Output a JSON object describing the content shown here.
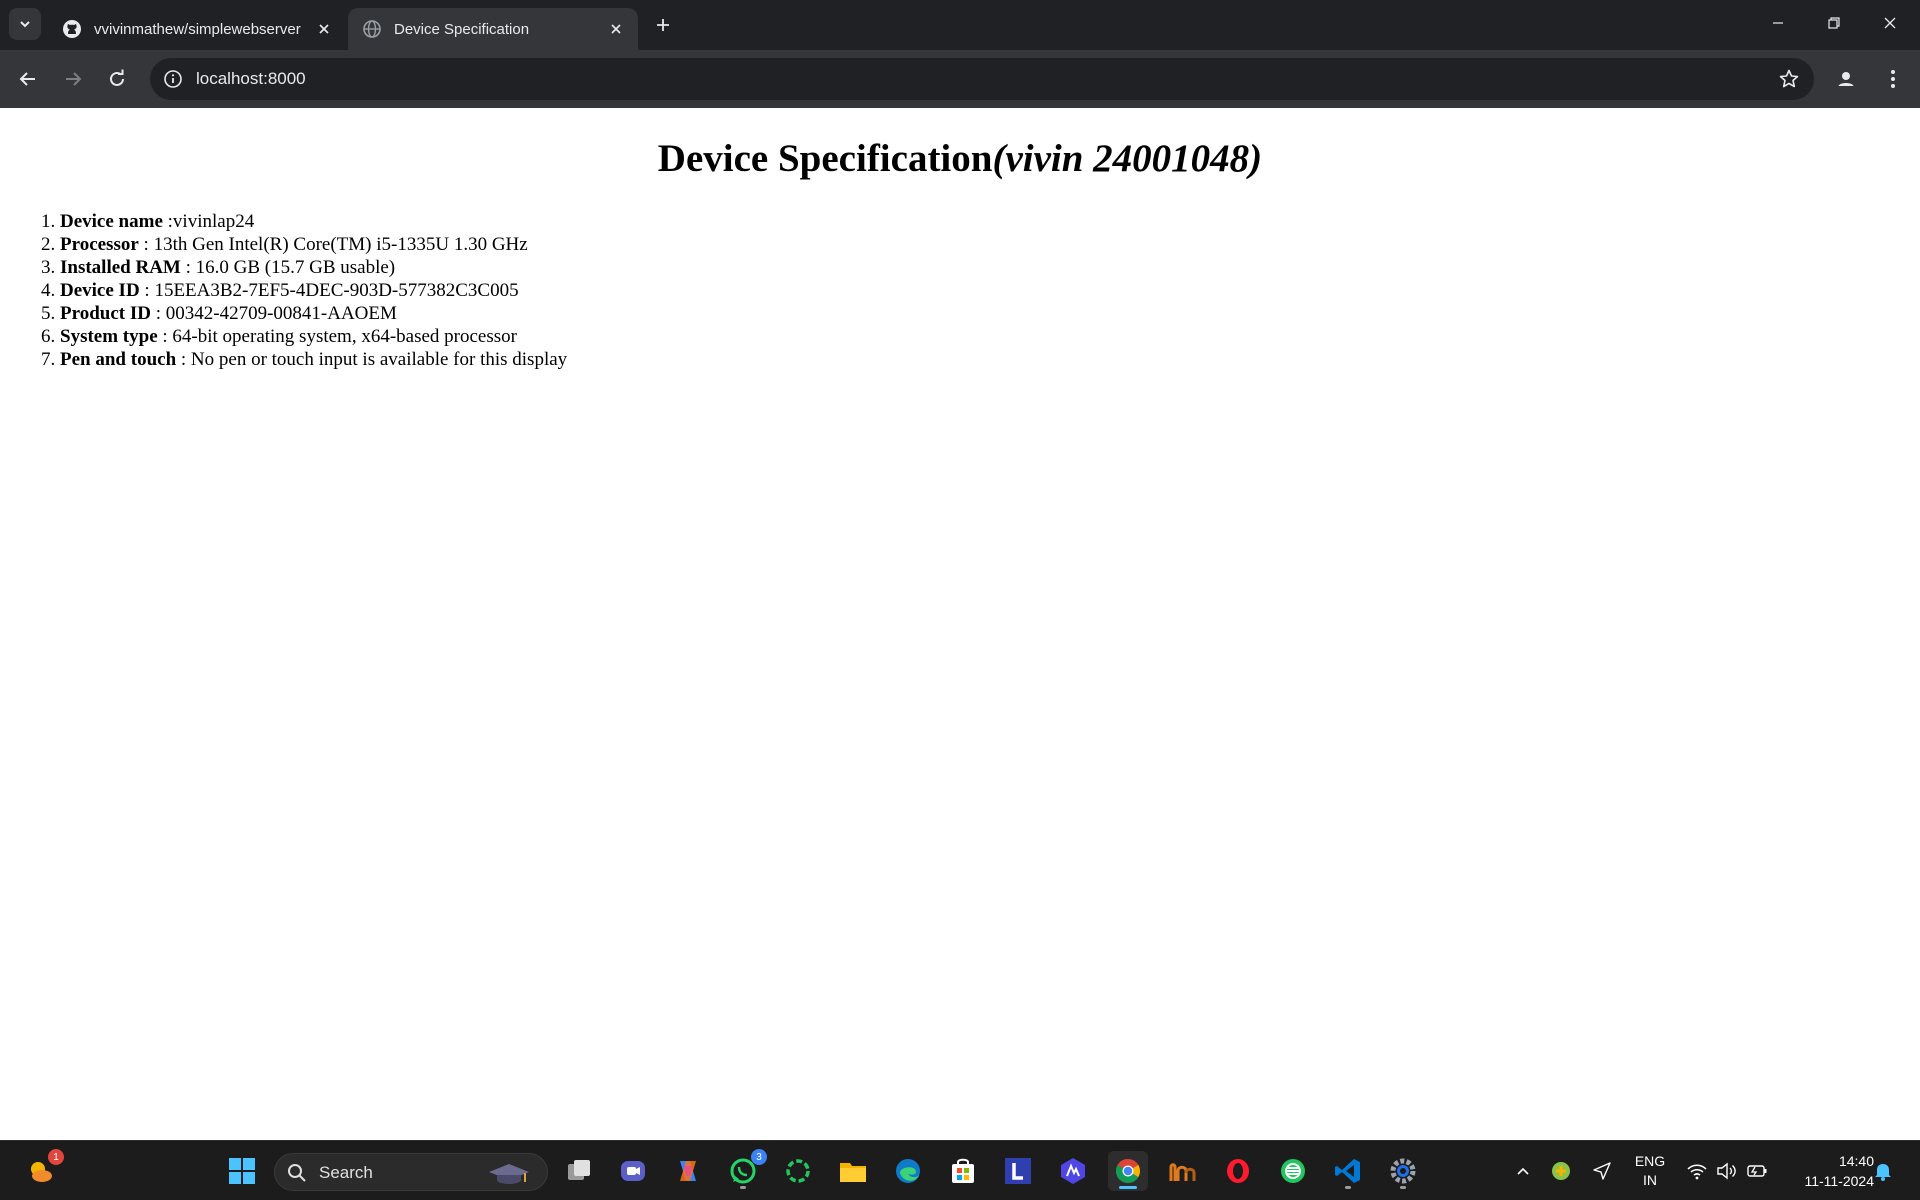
{
  "browser": {
    "tabs": [
      {
        "title": "vvivinmathew/simplewebserver",
        "active": false,
        "favicon": "github-icon"
      },
      {
        "title": "Device Specification",
        "active": true,
        "favicon": "globe-icon"
      }
    ],
    "address": "localhost:8000"
  },
  "page": {
    "heading_main": "Device Specification",
    "heading_italic": "(vivin 24001048)",
    "specs": [
      {
        "label": "Device name",
        "value": " :vivinlap24"
      },
      {
        "label": "Processor",
        "value": " : 13th Gen Intel(R) Core(TM) i5-1335U 1.30 GHz"
      },
      {
        "label": "Installed RAM",
        "value": " : 16.0 GB (15.7 GB usable)"
      },
      {
        "label": "Device ID",
        "value": " : 15EEA3B2-7EF5-4DEC-903D-577382C3C005"
      },
      {
        "label": "Product ID",
        "value": " : 00342-42709-00841-AAOEM"
      },
      {
        "label": "System type",
        "value": " : 64-bit operating system, x64-based processor"
      },
      {
        "label": "Pen and touch",
        "value": " : No pen or touch input is available for this display"
      }
    ]
  },
  "taskbar": {
    "weather_badge": "1",
    "search_label": "Search",
    "whatsapp_badge": "3",
    "apps": [
      "start-icon",
      "task-view-icon",
      "teams-icon",
      "copilot-icon",
      "whatsapp-icon",
      "ring-app-icon",
      "file-explorer-icon",
      "edge-icon",
      "store-icon",
      "l-app-icon",
      "aurora-icon",
      "chrome-icon",
      "maven-app-icon",
      "opera-icon",
      "green-app-icon",
      "vscode-icon",
      "settings-icon"
    ],
    "language_top": "ENG",
    "language_bottom": "IN",
    "time": "14:40",
    "date": "11-11-2024"
  },
  "colors": {
    "chrome_dark": "#202124",
    "chrome_toolbar": "#35363a",
    "taskbar": "#1c1c1c",
    "accent": "#4cc2ff"
  }
}
